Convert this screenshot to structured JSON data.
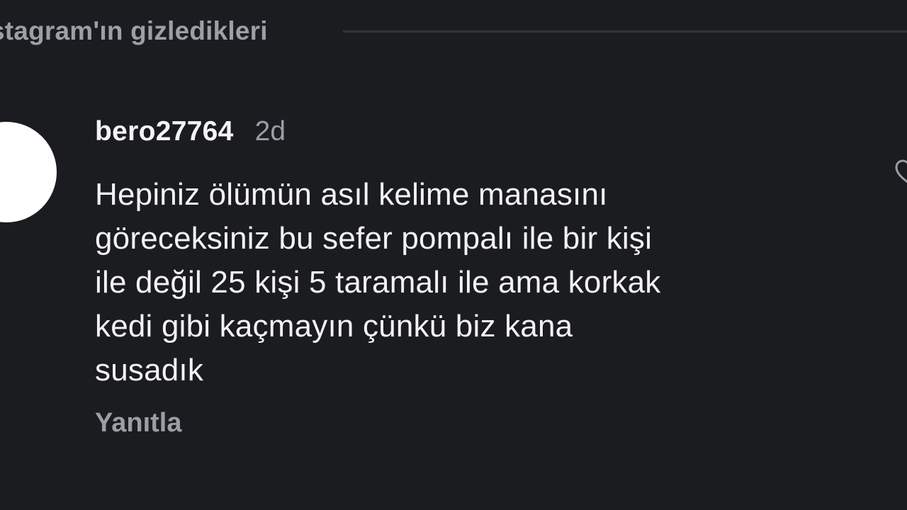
{
  "header": {
    "title": "stagram'ın gizledikleri"
  },
  "comment": {
    "username": "bero27764",
    "time": "2d",
    "text_lines": [
      "Hepiniz ölümün asıl kelime manasını",
      "göreceksiniz bu sefer pompalı ile bir kişi",
      "ile değil 25 kişi 5 taramalı ile ama korkak",
      "kedi gibi kaçmayın çünkü biz kana",
      "susadık"
    ],
    "reply_label": "Yanıtla",
    "avatar_icon": "profile-avatar",
    "like_icon": "heart-icon"
  },
  "colors": {
    "background": "#1b1c20",
    "primary_text": "#f2f2f4",
    "secondary_text": "#9c9da5",
    "divider": "#34353b"
  }
}
